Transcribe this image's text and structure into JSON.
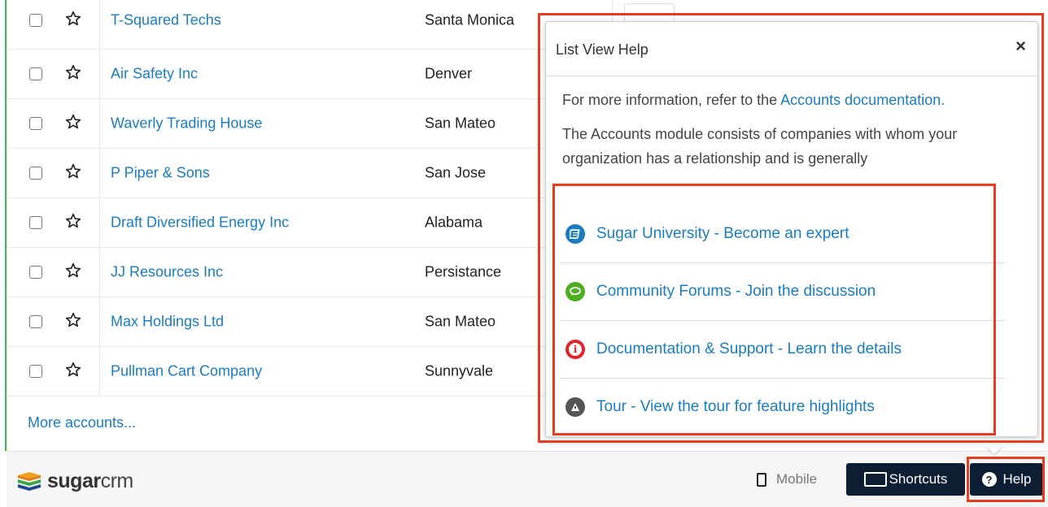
{
  "accounts": [
    {
      "name": "T-Squared Techs",
      "city": "Santa Monica"
    },
    {
      "name": "Air Safety Inc",
      "city": "Denver"
    },
    {
      "name": "Waverly Trading House",
      "city": "San Mateo"
    },
    {
      "name": "P Piper & Sons",
      "city": "San Jose"
    },
    {
      "name": "Draft Diversified Energy Inc",
      "city": "Alabama"
    },
    {
      "name": "JJ Resources Inc",
      "city": "Persistance"
    },
    {
      "name": "Max Holdings Ltd",
      "city": "San Mateo"
    },
    {
      "name": "Pullman Cart Company",
      "city": "Sunnyvale"
    }
  ],
  "more_link": "More accounts...",
  "help_popover": {
    "title": "List View Help",
    "intro_text": "For more information, refer to the ",
    "intro_link": "Accounts documentation.",
    "description": "The Accounts module consists of companies with whom your organization has a relationship and is generally",
    "links": [
      {
        "label": "Sugar University - Become an expert",
        "icon": "book-icon",
        "color": "#1a7cc0"
      },
      {
        "label": "Community Forums - Join the discussion",
        "icon": "chat-icon",
        "color": "#4caf22"
      },
      {
        "label": "Documentation & Support - Learn the details",
        "icon": "info-icon",
        "color": "#e0242a"
      },
      {
        "label": "Tour - View the tour for feature highlights",
        "icon": "tour-icon",
        "color": "#555555"
      }
    ]
  },
  "footer": {
    "logo_bold": "sugar",
    "logo_light": "crm",
    "mobile_label": "Mobile",
    "shortcuts_label": "Shortcuts",
    "help_label": "Help"
  },
  "colors": {
    "link": "#1a7cc0",
    "highlight": "#e83c1e",
    "footer_button": "#0b1e33"
  }
}
